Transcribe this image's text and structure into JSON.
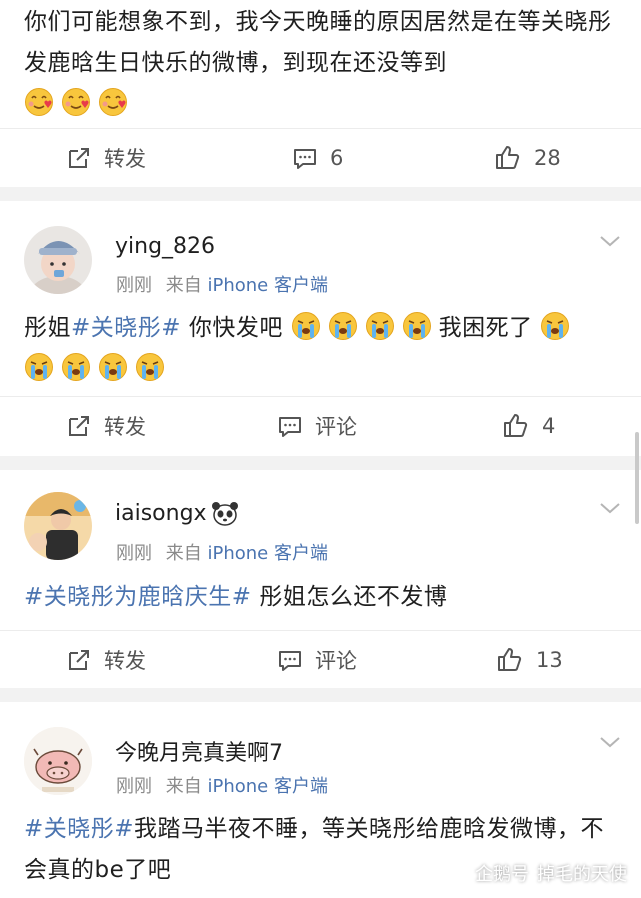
{
  "post": {
    "text": "你们可能想象不到，我今天晚睡的原因居然是在等关晓彤发鹿晗生日快乐的微博，到现在还没等到",
    "repost_label": "转发",
    "comment_count": "6",
    "like_count": "28"
  },
  "comments": [
    {
      "username": "ying_826",
      "time": "刚刚",
      "source_prefix": "来自",
      "source": "iPhone 客户端",
      "text_a": "彤姐",
      "topic": "#关晓彤#",
      "text_b": " 你快发吧",
      "text_c": "我困死了",
      "repost_label": "转发",
      "comment_label": "评论",
      "like_count": "4"
    },
    {
      "username": "iaisongx",
      "time": "刚刚",
      "source_prefix": "来自",
      "source": "iPhone 客户端",
      "topic": "#关晓彤为鹿晗庆生#",
      "text_b": " 彤姐怎么还不发博",
      "repost_label": "转发",
      "comment_label": "评论",
      "like_count": "13"
    },
    {
      "username": "今晚月亮真美啊7",
      "time": "刚刚",
      "source_prefix": "来自",
      "source": "iPhone 客户端",
      "topic": "#关晓彤#",
      "text_b": "我踏马半夜不睡，等关晓彤给鹿晗发微博，不会真的be了吧"
    }
  ],
  "watermark": {
    "brand": "企鹅号",
    "author": "掉毛的天使"
  },
  "colors": {
    "topic": "#4b74b0",
    "separator": "#f2f2f2",
    "meta": "#8a8a8a"
  }
}
